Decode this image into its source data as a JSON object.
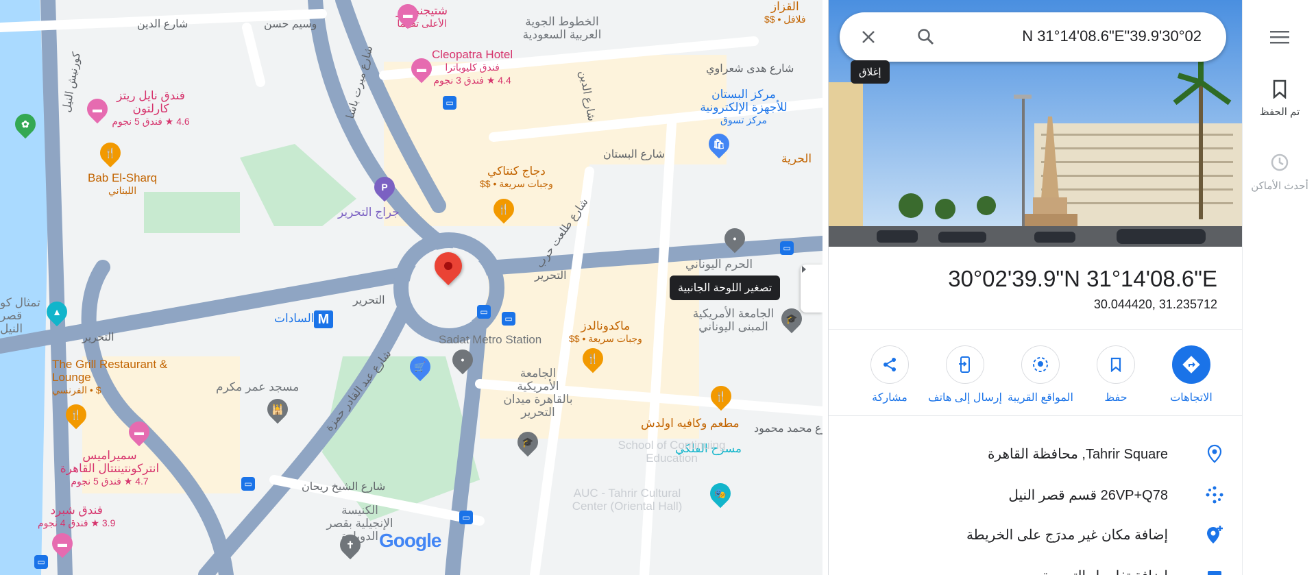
{
  "search": {
    "value": "N 31°14'08.6\"E\"39.9'30°02",
    "close_tooltip": "إغلاق"
  },
  "place": {
    "title": "30°02'39.9\"N 31°14'08.6\"E",
    "decimal": "30.044420, 31.235712"
  },
  "actions": [
    {
      "label": "الاتجاهات",
      "icon": "directions-icon"
    },
    {
      "label": "حفظ",
      "icon": "bookmark-icon"
    },
    {
      "label": "المواقع القريبة",
      "icon": "nearby-icon"
    },
    {
      "label": "إرسال إلى هاتف",
      "icon": "send-to-phone-icon"
    },
    {
      "label": "مشاركة",
      "icon": "share-icon"
    }
  ],
  "info_rows": [
    {
      "text": "Tahrir Square, محافظة القاهرة",
      "icon": "location-pin-icon"
    },
    {
      "text": "26VP+Q78 قسم قصر النيل",
      "icon": "plus-code-icon"
    },
    {
      "text": "إضافة مكان غير مدرَج على الخريطة",
      "icon": "add-place-icon"
    },
    {
      "text": "إضافة تفاصيل التسمية",
      "icon": "label-icon"
    }
  ],
  "rail": {
    "saved_label": "تم الحفظ",
    "recent_label": "أحدث الأماكن"
  },
  "map": {
    "collapse_tooltip": "تصغير اللوحة الجانبية",
    "google_logo": "Google",
    "street_labels": [
      "شارع التحرير",
      "التحرير",
      "التحرير",
      "التحرير",
      "شارع البستان",
      "شارع هدى شعراوي",
      "شارع طلعت حرب",
      "شارع محمد محمود",
      "شارع عبد القادر حمزة",
      "شارع الشيخ ريحان",
      "شارع الدين",
      "وسيم حسن",
      "وسيم حسن",
      "كورنيش النيل",
      "شارع ميرت باشا"
    ],
    "pois": {
      "cleopatra_name": "Cleopatra Hotel",
      "cleopatra_ar": "فندق كليوباترا",
      "cleopatra_rating": "4.4 ★ فندق 3 نجوم",
      "shtijen": "شتيجنبرجر",
      "shtijen_sub": "الأعلى تقييمًا",
      "saudi": "الخطوط الجوية العربية السعودية",
      "nile_ritz_ar": "فندق نايل ريتز كارلتون",
      "nile_ritz_rating": "4.6 ★ فندق 5 نجوم",
      "bab_elsharq": "Bab El-Sharq",
      "bab_elsharq_sub": "اللبناني",
      "garage": "جراج التحرير",
      "kentucky": "دجاج كنتاكي",
      "kentucky_sub": "وجبات سريعة • $$",
      "bustan": "مركز البستان للأجهزة الإلكترونية",
      "bustan_sub": "مركز تسوق",
      "greek_club": "الحرم اليوناني",
      "sadat": "السادات",
      "sadat_metro": "Sadat Metro Station",
      "mcdonalds": "ماكدونالدز",
      "mcdonalds_sub": "وجبات سريعة • $$",
      "auc_greek": "الجامعة الأمريكية المبنى اليوناني",
      "grill": "The Grill Restaurant & Lounge",
      "grill_sub": "الفرنسي • $",
      "omar_makram": "مسجد عمر مكرم",
      "auc_tahrir": "الجامعة الأمريكية بالقاهرة ميدان التحرير",
      "awlad": "مطعم وكافيه اولدش",
      "semiramis": "سميراميس انتركونتيننتال القاهرة",
      "semiramis_rating": "4.7 ★ فندق 5 نجوم",
      "shepheard": "فندق شبرد",
      "shepheard_rating": "3.9 ★ فندق 4 نجوم",
      "church": "الكنيسة الإنجيلية بقصر الدوبارة",
      "falaki": "مسرح الفلكي",
      "school": "School of Continuing Education",
      "auc_oriental": "AUC - Tahrir Cultural Center (Oriental Hall)",
      "nile_statue": "تمثال كو قصر النيل",
      "hurriya": "الحرية",
      "fazzaz": "القزاز",
      "fazzaz_sub": "فلافل • $$"
    }
  },
  "colors": {
    "accent": "#1a73e8",
    "pin_red": "#ea4335",
    "water": "#aadaff",
    "park": "#c8ead0",
    "road": "#8fa5c3"
  }
}
